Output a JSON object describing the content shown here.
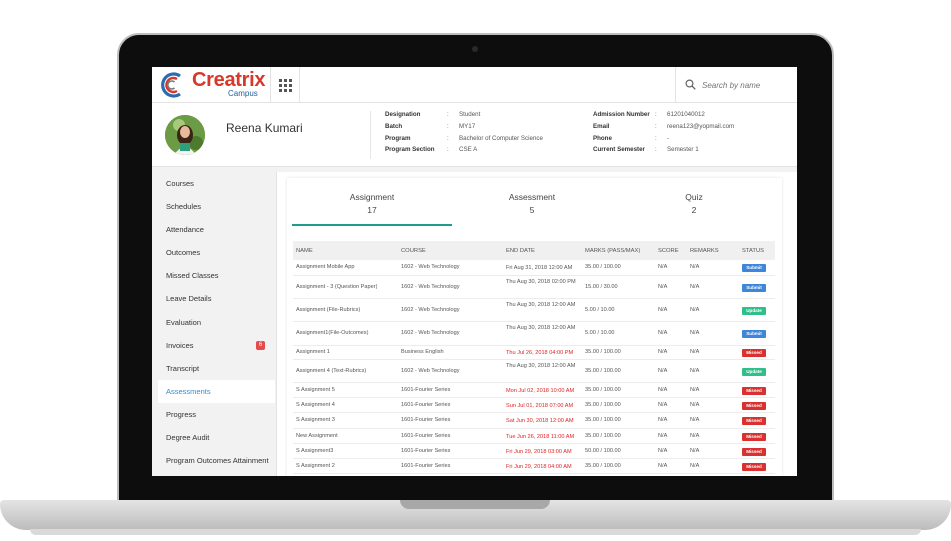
{
  "brand": {
    "name": "Creatrix",
    "subtitle": "Campus"
  },
  "search": {
    "placeholder": "Search by name"
  },
  "student": {
    "name": "Reena Kumari",
    "fields_left": [
      {
        "label": "Designation",
        "value": "Student"
      },
      {
        "label": "Batch",
        "value": "MY17"
      },
      {
        "label": "Program",
        "value": "Bachelor of Computer Science"
      },
      {
        "label": "Program Section",
        "value": "CSE A"
      }
    ],
    "fields_right": [
      {
        "label": "Admission Number",
        "value": "61201040012"
      },
      {
        "label": "Email",
        "value": "reena123@yopmail.com"
      },
      {
        "label": "Phone",
        "value": "-"
      },
      {
        "label": "Current Semester",
        "value": "Semester 1"
      }
    ]
  },
  "sidebar": {
    "items": [
      {
        "label": "Courses"
      },
      {
        "label": "Schedules"
      },
      {
        "label": "Attendance"
      },
      {
        "label": "Outcomes"
      },
      {
        "label": "Missed Classes"
      },
      {
        "label": "Leave Details"
      },
      {
        "label": "Evaluation"
      },
      {
        "label": "Invoices",
        "badge": "6"
      },
      {
        "label": "Transcript"
      },
      {
        "label": "Assessments",
        "active": true
      },
      {
        "label": "Progress"
      },
      {
        "label": "Degree Audit"
      },
      {
        "label": "Program Outcomes Attainment"
      }
    ]
  },
  "tabs": [
    {
      "label": "Assignment",
      "count": "17",
      "active": true
    },
    {
      "label": "Assessment",
      "count": "5"
    },
    {
      "label": "Quiz",
      "count": "2"
    }
  ],
  "table": {
    "headers": [
      "NAME",
      "COURSE",
      "END DATE",
      "MARKS (PASS/MAX)",
      "SCORE",
      "REMARKS",
      "STATUS"
    ],
    "rows": [
      {
        "name": "Assignment Mobile App",
        "course": "1602 - Web Technology",
        "end_date": "Fri Aug 31, 2018 12:00 AM",
        "overdue": false,
        "marks": "35.00 / 100.00",
        "score": "N/A",
        "remarks": "N/A",
        "status": "Submit"
      },
      {
        "name": "Assignment - 3 (Question Paper)",
        "course": "1602 - Web Technology",
        "end_date": "Thu Aug 30, 2018 02:00 PM",
        "overdue": false,
        "marks": "15.00 / 30.00",
        "score": "N/A",
        "remarks": "N/A",
        "status": "Submit"
      },
      {
        "name": "Assignment (File-Rubrics)",
        "course": "1602 - Web Technology",
        "end_date": "Thu Aug 30, 2018 12:00 AM",
        "overdue": false,
        "marks": "5.00 / 10.00",
        "score": "N/A",
        "remarks": "N/A",
        "status": "Update"
      },
      {
        "name": "Assignment1(File-Outcomes)",
        "course": "1602 - Web Technology",
        "end_date": "Thu Aug 30, 2018 12:00 AM",
        "overdue": false,
        "marks": "5.00 / 10.00",
        "score": "N/A",
        "remarks": "N/A",
        "status": "Submit"
      },
      {
        "name": "Assignment 1",
        "course": "Business English",
        "end_date": "Thu Jul 26, 2018 04:00 PM",
        "overdue": true,
        "marks": "35.00 / 100.00",
        "score": "N/A",
        "remarks": "N/A",
        "status": "Missed"
      },
      {
        "name": "Assignment 4 (Text-Rubrics)",
        "course": "1602 - Web Technology",
        "end_date": "Thu Aug 30, 2018 12:00 AM",
        "overdue": false,
        "marks": "35.00 / 100.00",
        "score": "N/A",
        "remarks": "N/A",
        "status": "Update"
      },
      {
        "name": "S Assignment 5",
        "course": "1601-Fourier Series",
        "end_date": "Mon Jul 02, 2018 10:00 AM",
        "overdue": true,
        "marks": "35.00 / 100.00",
        "score": "N/A",
        "remarks": "N/A",
        "status": "Missed"
      },
      {
        "name": "S Assignment 4",
        "course": "1601-Fourier Series",
        "end_date": "Sun Jul 01, 2018 07:00 AM",
        "overdue": true,
        "marks": "35.00 / 100.00",
        "score": "N/A",
        "remarks": "N/A",
        "status": "Missed"
      },
      {
        "name": "S Assignment 3",
        "course": "1601-Fourier Series",
        "end_date": "Sat Jun 30, 2018 12:00 AM",
        "overdue": true,
        "marks": "35.00 / 100.00",
        "score": "N/A",
        "remarks": "N/A",
        "status": "Missed"
      },
      {
        "name": "New Assignment",
        "course": "1601-Fourier Series",
        "end_date": "Tue Jun 26, 2018 11:00 AM",
        "overdue": true,
        "marks": "35.00 / 100.00",
        "score": "N/A",
        "remarks": "N/A",
        "status": "Missed"
      },
      {
        "name": "S Assignment3",
        "course": "1601-Fourier Series",
        "end_date": "Fri Jun 29, 2018 03:00 AM",
        "overdue": true,
        "marks": "50.00 / 100.00",
        "score": "N/A",
        "remarks": "N/A",
        "status": "Missed"
      },
      {
        "name": "S Assignment 2",
        "course": "1601-Fourier Series",
        "end_date": "Fri Jun 29, 2018 04:00 AM",
        "overdue": true,
        "marks": "35.00 / 100.00",
        "score": "N/A",
        "remarks": "N/A",
        "status": "Missed"
      }
    ]
  },
  "colors": {
    "accent": "#1f9c8a",
    "link": "#2f8fd1",
    "brand_red": "#d6382a",
    "brand_blue": "#1f5f9e",
    "submit": "#3d86d9",
    "update": "#2fbf8a",
    "missed": "#d93030",
    "overdue_text": "#e02424"
  }
}
